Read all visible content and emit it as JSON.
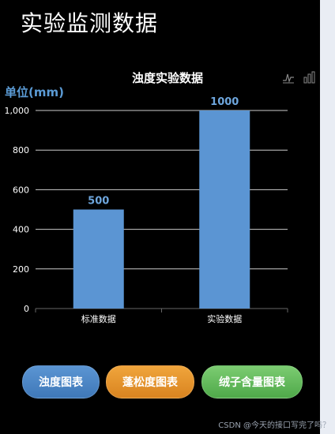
{
  "page": {
    "title": "实验监测数据"
  },
  "chart_data": {
    "type": "bar",
    "title": "浊度实验数据",
    "ylabel": "单位(mm)",
    "categories": [
      "标准数据",
      "实验数据"
    ],
    "values": [
      500,
      1000
    ],
    "data_labels": [
      "500",
      "1000"
    ],
    "ylim": [
      0,
      1000
    ],
    "yticks": [
      0,
      200,
      400,
      600,
      800,
      1000
    ],
    "ytick_labels": [
      "0",
      "200",
      "400",
      "600",
      "800",
      "1,000"
    ],
    "grid": true,
    "bar_color": "#5b95d3"
  },
  "toolbox": {
    "icons": [
      "line-chart-icon",
      "bar-chart-icon"
    ]
  },
  "buttons": [
    {
      "label": "浊度图表",
      "color_from": "#5b95d3",
      "color_to": "#3f78b8"
    },
    {
      "label": "蓬松度图表",
      "color_from": "#f0a53c",
      "color_to": "#d98420"
    },
    {
      "label": "绒子含量图表",
      "color_from": "#7ccc72",
      "color_to": "#4fa94a"
    }
  ],
  "watermark": "CSDN @今天的接口写完了吗？"
}
